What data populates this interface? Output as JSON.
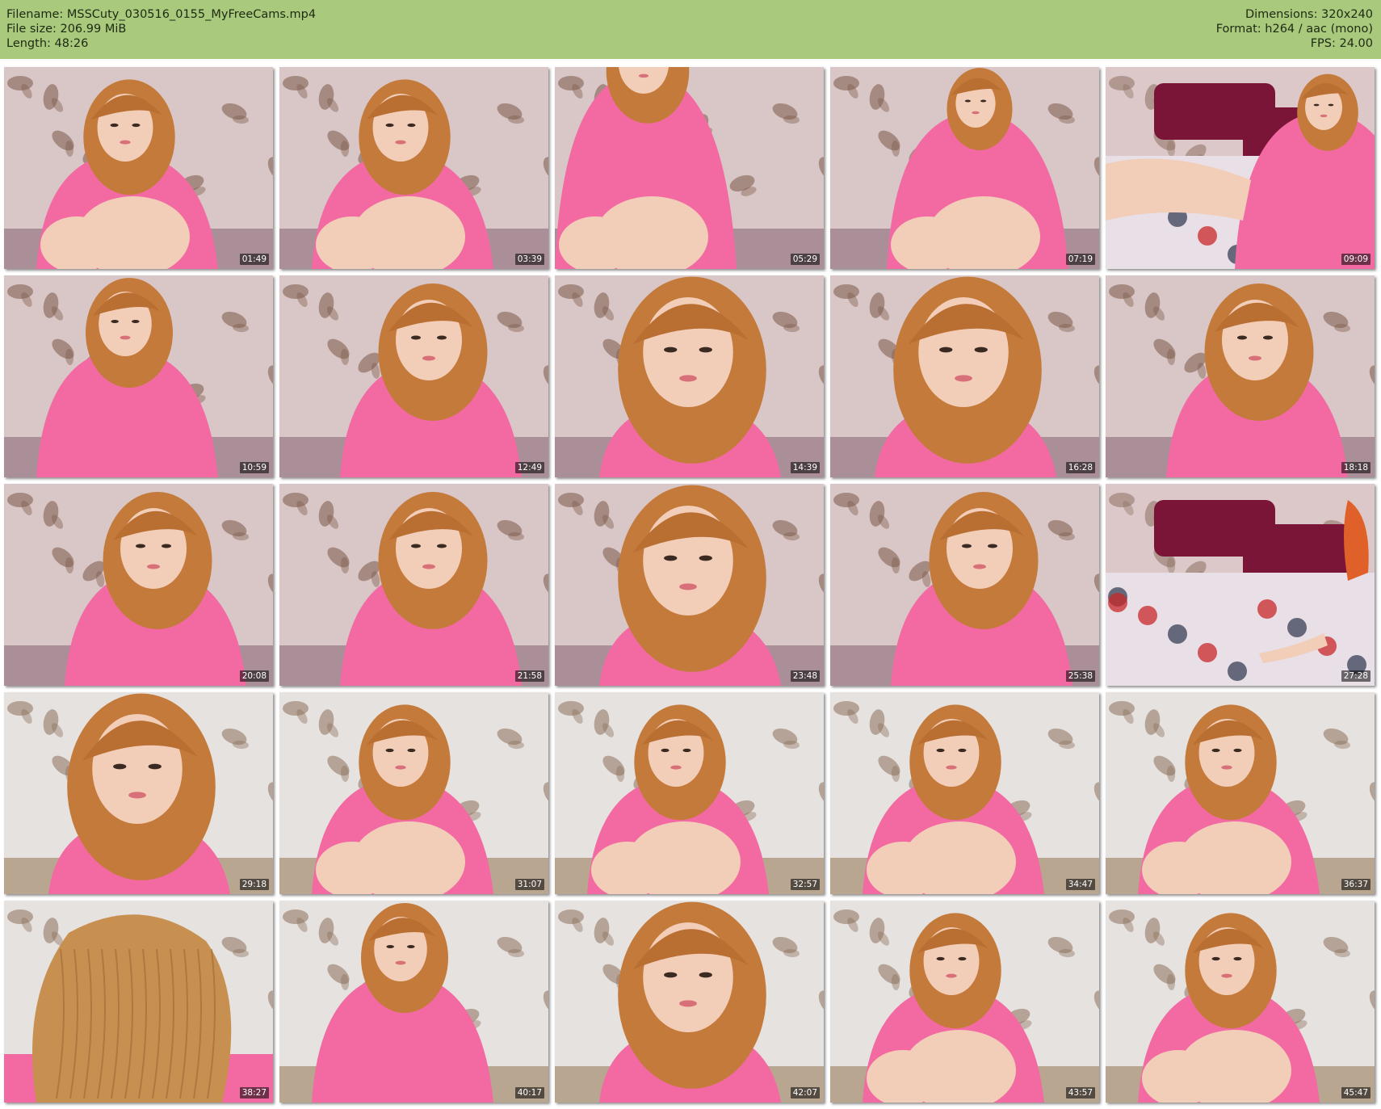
{
  "header": {
    "filename_line": "Filename: MSSCuty_030516_0155_MyFreeCams.mp4",
    "filesize_line": "File size: 206.99 MiB",
    "length_line": "Length: 48:26",
    "dimensions_line": "Dimensions: 320x240",
    "format_line": "Format: h264 / aac (mono)",
    "fps_line": "FPS: 24.00",
    "background_color": "#a9c97d"
  },
  "thumbnails": [
    {
      "timestamp": "01:49",
      "scene": "wallpaper",
      "pose": "sitting-knees"
    },
    {
      "timestamp": "03:39",
      "scene": "wallpaper",
      "pose": "sitting-knees"
    },
    {
      "timestamp": "05:29",
      "scene": "wallpaper",
      "pose": "legs"
    },
    {
      "timestamp": "07:19",
      "scene": "wallpaper",
      "pose": "lying-side"
    },
    {
      "timestamp": "09:09",
      "scene": "bed",
      "pose": "lying-back"
    },
    {
      "timestamp": "10:59",
      "scene": "wallpaper",
      "pose": "upper-body"
    },
    {
      "timestamp": "12:49",
      "scene": "wallpaper",
      "pose": "lying-front"
    },
    {
      "timestamp": "14:39",
      "scene": "wallpaper",
      "pose": "closeup"
    },
    {
      "timestamp": "16:28",
      "scene": "wallpaper",
      "pose": "closeup"
    },
    {
      "timestamp": "18:18",
      "scene": "wallpaper",
      "pose": "lying-front"
    },
    {
      "timestamp": "20:08",
      "scene": "wallpaper",
      "pose": "lying-front"
    },
    {
      "timestamp": "21:58",
      "scene": "wallpaper",
      "pose": "lying-front"
    },
    {
      "timestamp": "23:48",
      "scene": "wallpaper",
      "pose": "closeup"
    },
    {
      "timestamp": "25:38",
      "scene": "wallpaper",
      "pose": "lying-front"
    },
    {
      "timestamp": "27:28",
      "scene": "bed",
      "pose": "empty-bed"
    },
    {
      "timestamp": "29:18",
      "scene": "light-wallpaper",
      "pose": "closeup"
    },
    {
      "timestamp": "31:07",
      "scene": "light-wallpaper",
      "pose": "sitting-knees"
    },
    {
      "timestamp": "32:57",
      "scene": "light-wallpaper",
      "pose": "sitting-knees"
    },
    {
      "timestamp": "34:47",
      "scene": "light-wallpaper",
      "pose": "sitting-knees"
    },
    {
      "timestamp": "36:37",
      "scene": "light-wallpaper",
      "pose": "sitting-knees"
    },
    {
      "timestamp": "38:27",
      "scene": "light-wallpaper",
      "pose": "hair-closeup"
    },
    {
      "timestamp": "40:17",
      "scene": "light-wallpaper",
      "pose": "upper-body"
    },
    {
      "timestamp": "42:07",
      "scene": "light-wallpaper",
      "pose": "closeup"
    },
    {
      "timestamp": "43:57",
      "scene": "light-wallpaper",
      "pose": "sitting-knees"
    },
    {
      "timestamp": "45:47",
      "scene": "light-wallpaper",
      "pose": "sitting-knees"
    }
  ],
  "colors": {
    "shirt": "#f36aa3",
    "hair": "#c47a3a",
    "skin": "#f2cdb8",
    "wallpaper": "#d9c6c6",
    "pillow": "#7a1538"
  }
}
